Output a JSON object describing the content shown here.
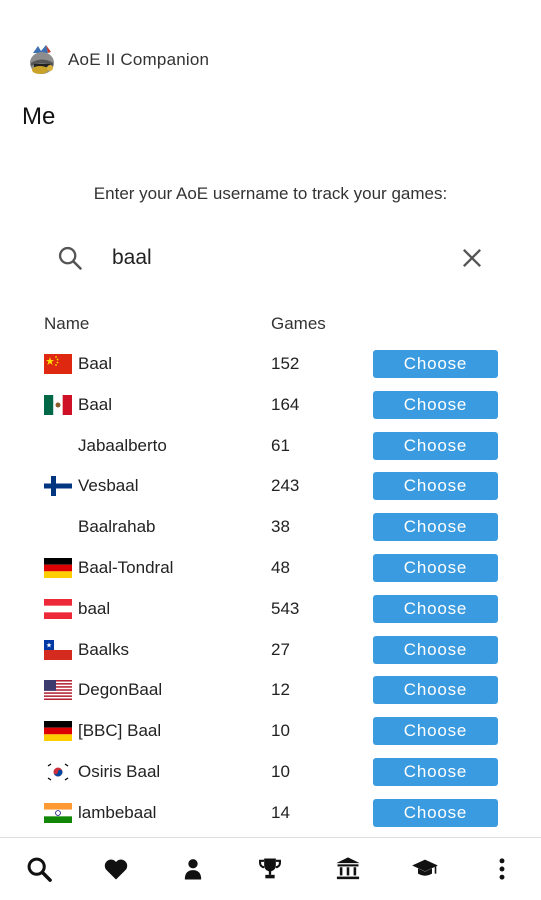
{
  "app": {
    "title": "AoE II Companion",
    "logo_icon": "knight-helmet-icon"
  },
  "page": {
    "title": "Me"
  },
  "instruction": "Enter your AoE username to track your games:",
  "search": {
    "value": "baal",
    "icon": "search-icon",
    "clear_icon": "close-icon"
  },
  "table": {
    "headers": {
      "name": "Name",
      "games": "Games"
    },
    "button_label": "Choose",
    "rows": [
      {
        "flag": "cn",
        "name": "Baal",
        "games": "152"
      },
      {
        "flag": "mx",
        "name": "Baal",
        "games": "164"
      },
      {
        "flag": "",
        "name": "Jabaalberto",
        "games": "61"
      },
      {
        "flag": "fi",
        "name": "Vesbaal",
        "games": "243"
      },
      {
        "flag": "",
        "name": "Baalrahab",
        "games": "38"
      },
      {
        "flag": "de",
        "name": "Baal-Tondral",
        "games": "48"
      },
      {
        "flag": "at",
        "name": "baal",
        "games": "543"
      },
      {
        "flag": "cl",
        "name": "Baalks",
        "games": "27"
      },
      {
        "flag": "us",
        "name": "DegonBaal",
        "games": "12"
      },
      {
        "flag": "de",
        "name": "[BBC] Baal",
        "games": "10"
      },
      {
        "flag": "kr",
        "name": "Osiris Baal",
        "games": "10"
      },
      {
        "flag": "in",
        "name": "lambebaal",
        "games": "14"
      }
    ]
  },
  "bottom_nav": [
    {
      "name": "search",
      "icon": "search-icon"
    },
    {
      "name": "favorites",
      "icon": "heart-icon"
    },
    {
      "name": "me",
      "icon": "user-icon"
    },
    {
      "name": "leaderboard",
      "icon": "trophy-icon"
    },
    {
      "name": "civilizations",
      "icon": "museum-icon"
    },
    {
      "name": "learn",
      "icon": "graduation-cap-icon"
    },
    {
      "name": "more",
      "icon": "more-vertical-icon"
    }
  ],
  "colors": {
    "button": "#3a9be0",
    "button_text": "#ffffff"
  }
}
